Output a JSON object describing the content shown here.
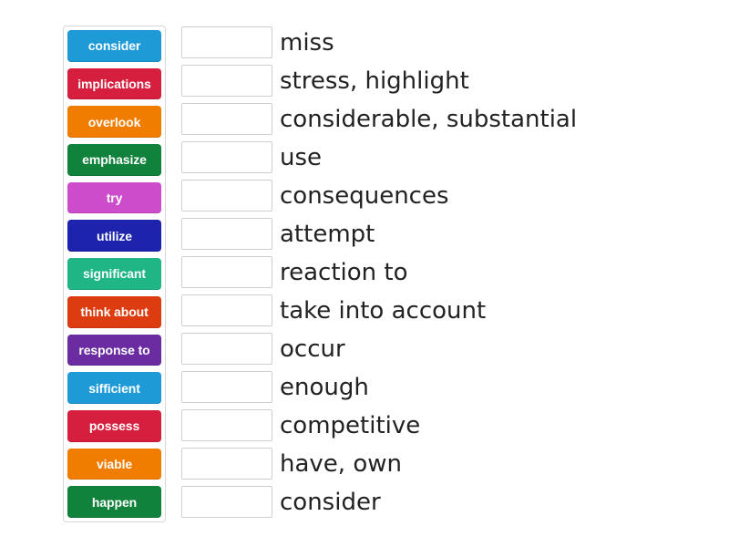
{
  "activity": {
    "type": "match-up",
    "tray_label": "Word tiles",
    "list_label": "Definitions with drop zones"
  },
  "tiles": [
    {
      "label": "consider",
      "color": "#1e9bd7"
    },
    {
      "label": "implications",
      "color": "#d61f3e"
    },
    {
      "label": "overlook",
      "color": "#f07c00"
    },
    {
      "label": "emphasize",
      "color": "#11823b"
    },
    {
      "label": "try",
      "color": "#c councils"
    },
    {
      "label": "utilize",
      "color": "#1d23ad"
    },
    {
      "label": "significant",
      "color": "#1fb584"
    },
    {
      "label": "think about",
      "color": "#dd3c11"
    },
    {
      "label": "response to",
      "color": "#6a2ca0"
    },
    {
      "label": "sifficient",
      "color": "#1e9bd7"
    },
    {
      "label": "possess",
      "color": "#d61f3e"
    },
    {
      "label": "viable",
      "color": "#f07c00"
    },
    {
      "label": "happen",
      "color": "#11823b"
    }
  ],
  "answers": [
    {
      "definition": "miss",
      "slot_value": ""
    },
    {
      "definition": "stress, highlight",
      "slot_value": ""
    },
    {
      "definition": "considerable, substantial",
      "slot_value": ""
    },
    {
      "definition": "use",
      "slot_value": ""
    },
    {
      "definition": "consequences",
      "slot_value": ""
    },
    {
      "definition": "attempt",
      "slot_value": ""
    },
    {
      "definition": "reaction to",
      "slot_value": ""
    },
    {
      "definition": "take into account",
      "slot_value": ""
    },
    {
      "definition": "occur",
      "slot_value": ""
    },
    {
      "definition": "enough",
      "slot_value": ""
    },
    {
      "definition": "competitive",
      "slot_value": ""
    },
    {
      "definition": "have, own",
      "slot_value": ""
    },
    {
      "definition": "consider",
      "slot_value": ""
    }
  ]
}
